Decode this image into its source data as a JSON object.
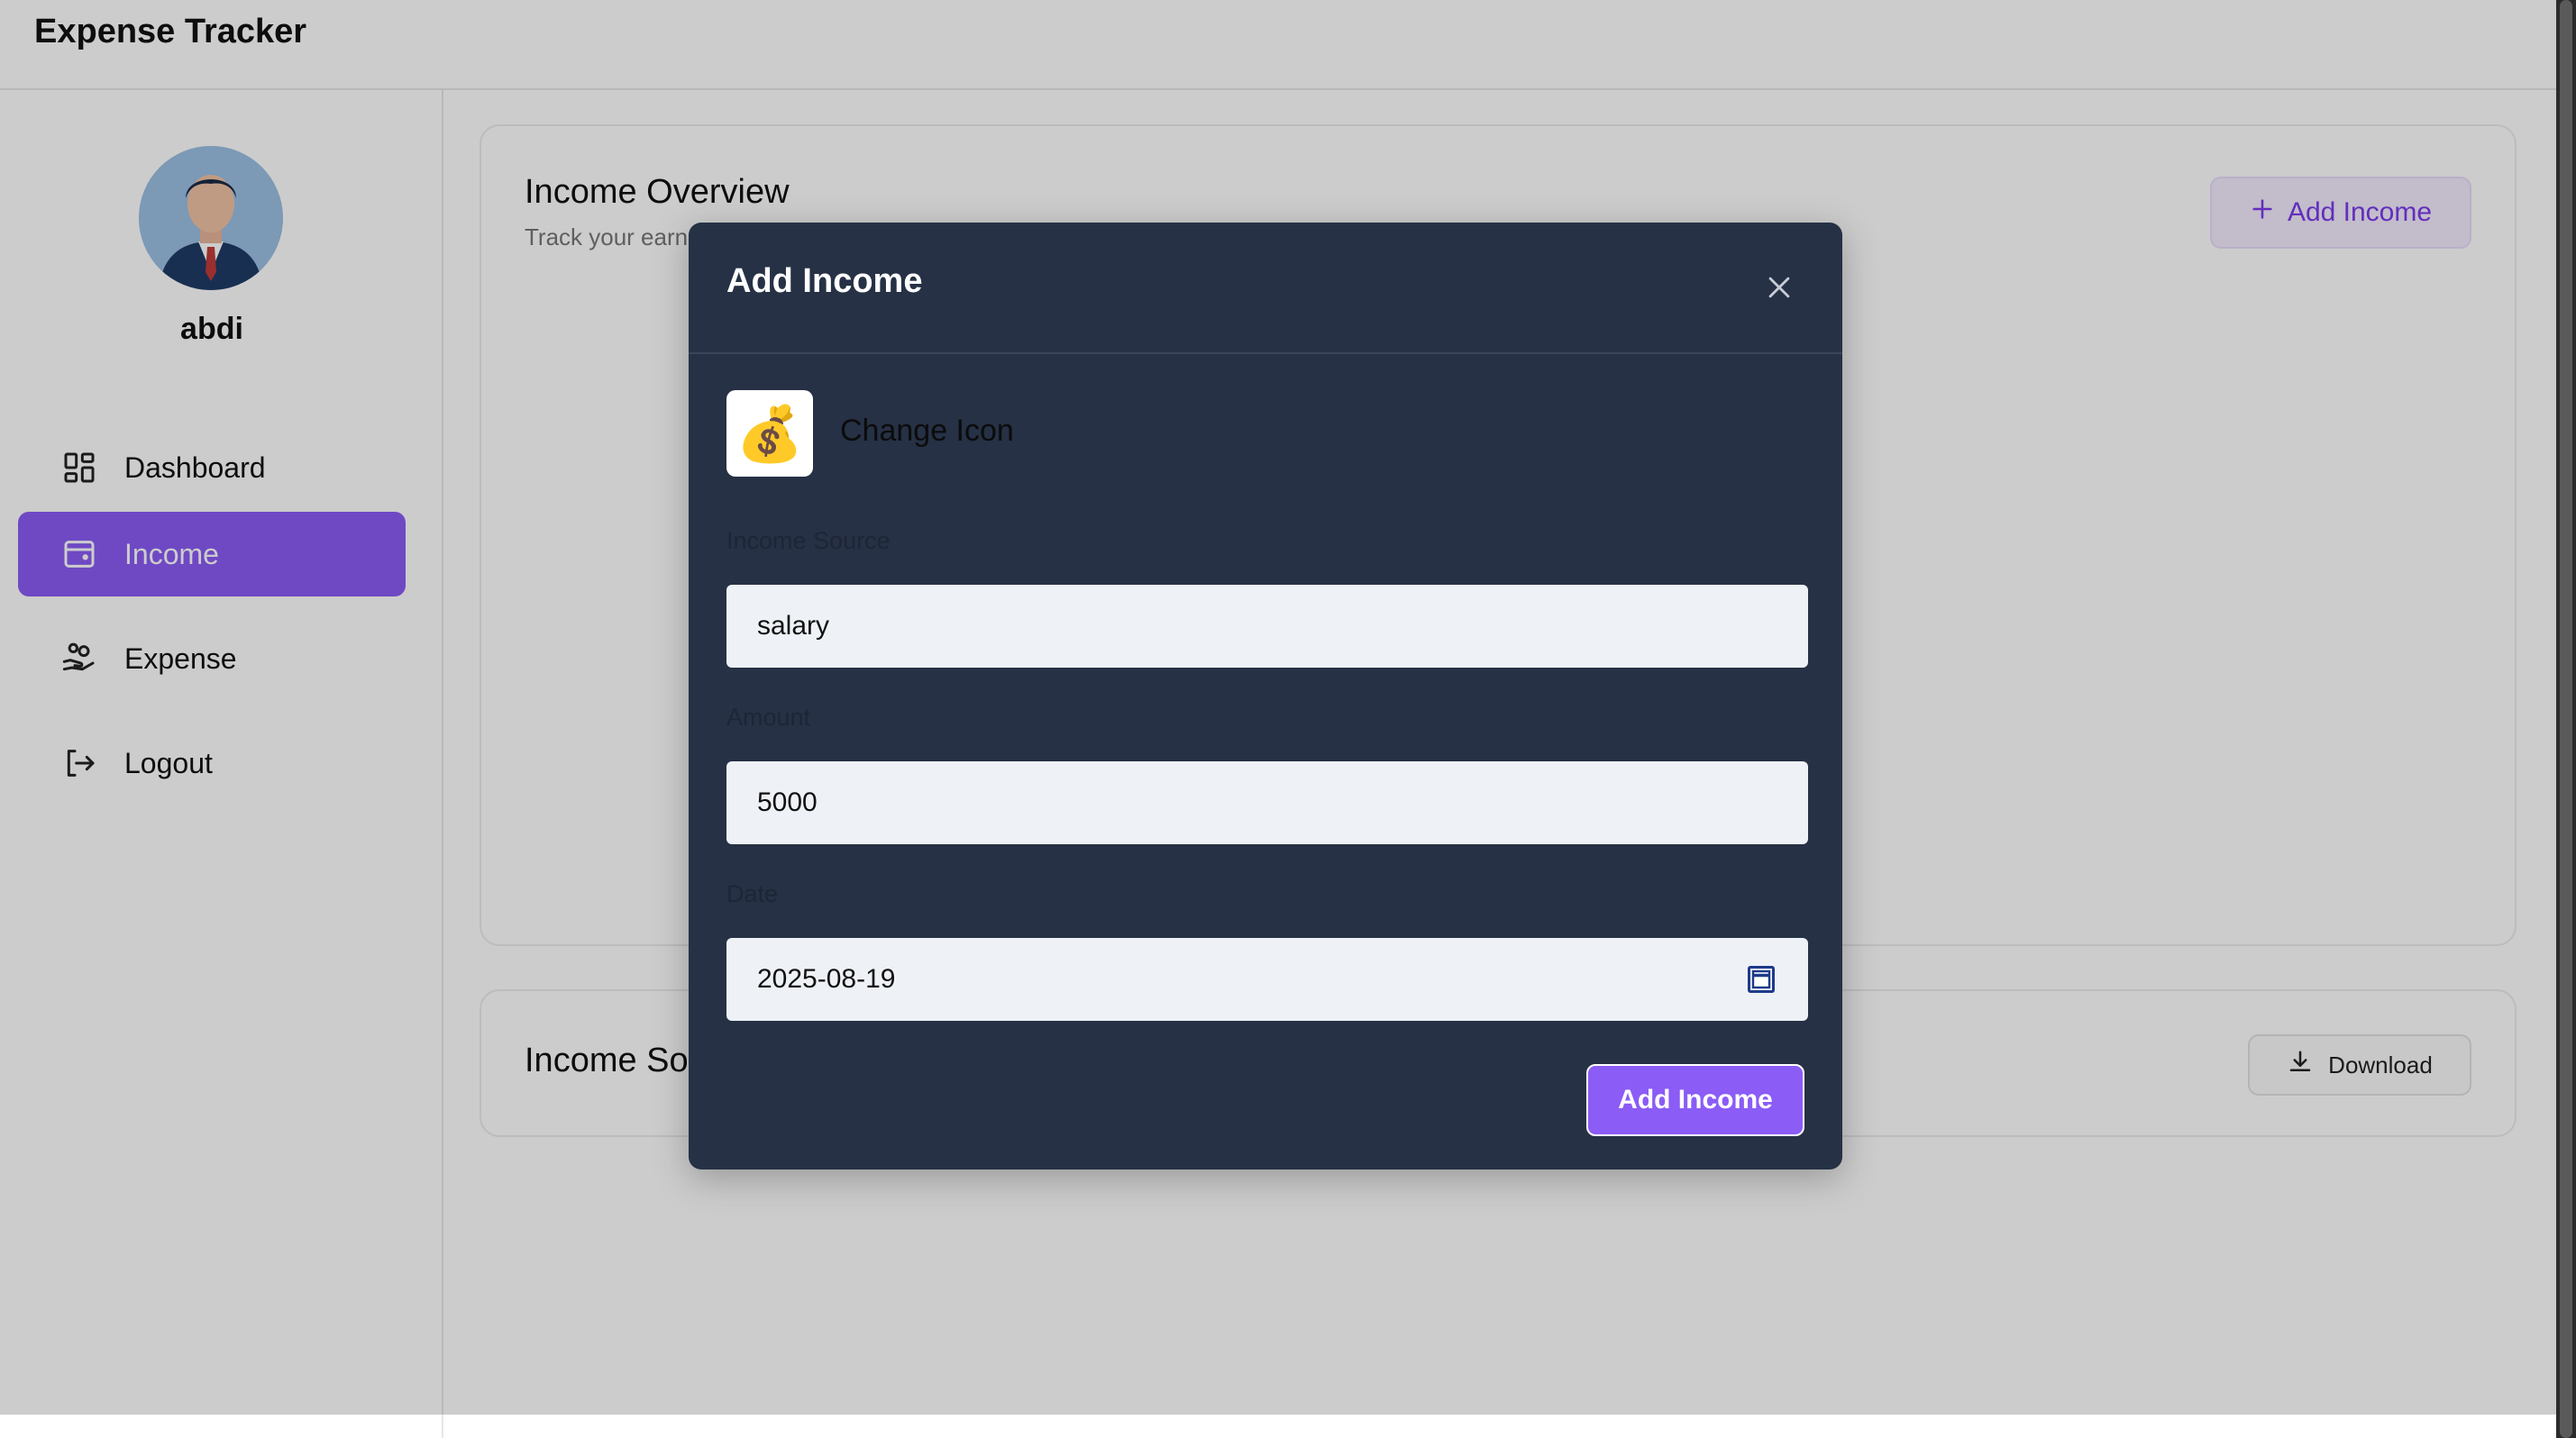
{
  "app": {
    "title": "Expense Tracker"
  },
  "user": {
    "name": "abdi"
  },
  "sidebar": {
    "items": [
      {
        "label": "Dashboard",
        "icon": "dashboard-grid-icon",
        "active": false
      },
      {
        "label": "Income",
        "icon": "wallet-icon",
        "active": true
      },
      {
        "label": "Expense",
        "icon": "hand-coins-icon",
        "active": false
      },
      {
        "label": "Logout",
        "icon": "logout-icon",
        "active": false
      }
    ]
  },
  "overview": {
    "title": "Income Overview",
    "subtitle": "Track your earn",
    "add_button_label": "Add Income"
  },
  "sources": {
    "title": "Income So",
    "download_label": "Download"
  },
  "modal": {
    "title": "Add Income",
    "emoji": "💰",
    "change_icon_label": "Change Icon",
    "source_label": "Income Source",
    "source_value": "salary",
    "amount_label": "Amount",
    "amount_value": "5000",
    "date_label": "Date",
    "date_value": "2025-08-19",
    "submit_label": "Add Income"
  },
  "colors": {
    "accent": "#8b5cf6",
    "modal_bg": "#263145",
    "input_bg": "#eef2f7"
  }
}
